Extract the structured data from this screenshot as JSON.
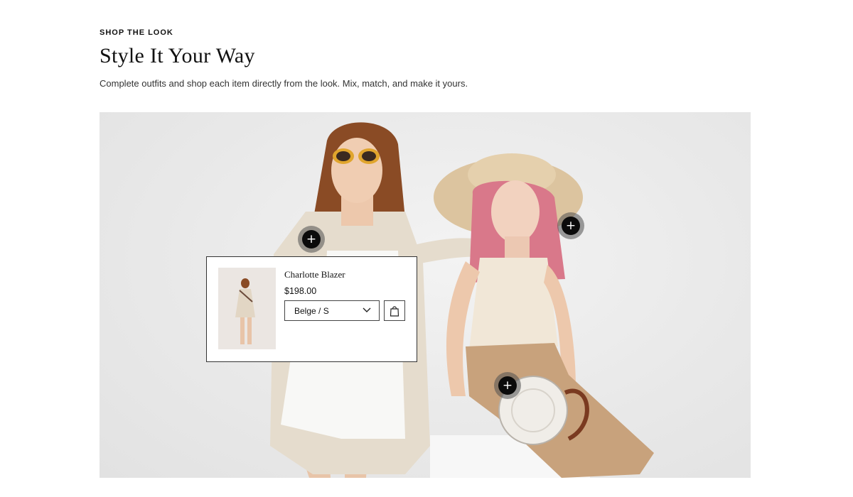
{
  "section": {
    "eyebrow": "SHOP THE LOOK",
    "title": "Style It Your Way",
    "subtitle": "Complete outfits and shop each item directly from the look. Mix, match, and make it yours."
  },
  "hotspots": [
    {
      "name": "hotspot-blazer",
      "icon": "plus-icon",
      "glyph": "+"
    },
    {
      "name": "hotspot-hat",
      "icon": "plus-icon",
      "glyph": "+"
    },
    {
      "name": "hotspot-bag",
      "icon": "plus-icon",
      "glyph": "+"
    }
  ],
  "product_popup": {
    "name": "Charlotte Blazer",
    "price": "$198.00",
    "variant": "Belge / S",
    "variant_icon": "chevron-down-icon",
    "cart_icon": "shopping-bag-icon"
  },
  "colors": {
    "background": "#ffffff",
    "hero_background": "#e9e9e9",
    "hotspot": "#0b0b0b",
    "text": "#111111"
  }
}
